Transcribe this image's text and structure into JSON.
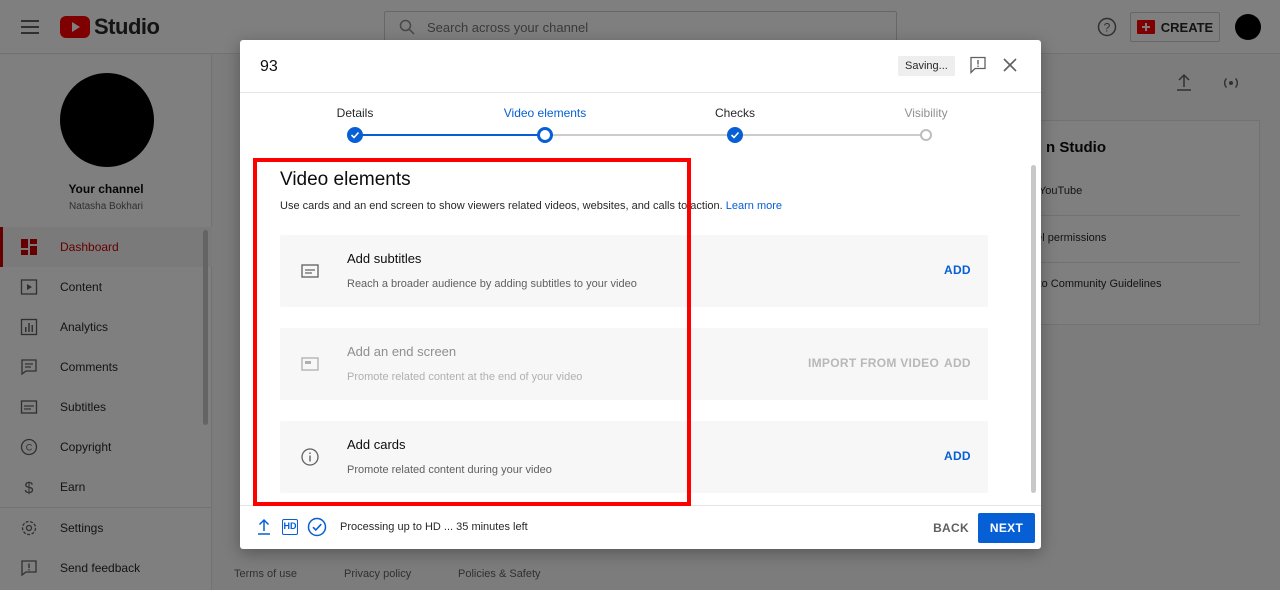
{
  "topbar": {
    "logo_text": "Studio",
    "search_placeholder": "Search across your channel",
    "create_label": "CREATE"
  },
  "sidebar": {
    "channel_title": "Your channel",
    "channel_name": "Natasha Bokhari",
    "items": [
      {
        "label": "Dashboard",
        "icon": "dashboard-icon",
        "active": true
      },
      {
        "label": "Content",
        "icon": "content-icon"
      },
      {
        "label": "Analytics",
        "icon": "analytics-icon"
      },
      {
        "label": "Comments",
        "icon": "comments-icon"
      },
      {
        "label": "Subtitles",
        "icon": "subtitles-icon"
      },
      {
        "label": "Copyright",
        "icon": "copyright-icon"
      },
      {
        "label": "Earn",
        "icon": "earn-icon"
      },
      {
        "label": "Settings",
        "icon": "settings-icon"
      },
      {
        "label": "Send feedback",
        "icon": "feedback-icon"
      }
    ]
  },
  "background": {
    "card_title": "n Studio",
    "lines": [
      "n YouTube",
      "nel permissions",
      "s to Community Guidelines"
    ],
    "footer_links": [
      "Terms of use",
      "Privacy policy",
      "Policies & Safety"
    ]
  },
  "dialog": {
    "title": "93",
    "saving_label": "Saving...",
    "steps": [
      {
        "label": "Details",
        "state": "done"
      },
      {
        "label": "Video elements",
        "state": "current"
      },
      {
        "label": "Checks",
        "state": "done"
      },
      {
        "label": "Visibility",
        "state": "todo"
      }
    ],
    "section_title": "Video elements",
    "section_desc": "Use cards and an end screen to show viewers related videos, websites, and calls to action.",
    "learn_more": "Learn more",
    "elements": [
      {
        "title": "Add subtitles",
        "desc": "Reach a broader audience by adding subtitles to your video",
        "action": "ADD",
        "icon": "subtitles-icon",
        "disabled": false
      },
      {
        "title": "Add an end screen",
        "desc": "Promote related content at the end of your video",
        "secondary_action": "IMPORT FROM VIDEO",
        "action": "ADD",
        "icon": "end-screen-icon",
        "disabled": true
      },
      {
        "title": "Add cards",
        "desc": "Promote related content during your video",
        "action": "ADD",
        "icon": "info-icon",
        "disabled": false
      }
    ],
    "footer_status": "Processing up to HD ... 35 minutes left",
    "hd_label": "HD",
    "back_label": "BACK",
    "next_label": "NEXT"
  },
  "colors": {
    "accent": "#065fd4",
    "brand_red": "#ff0000",
    "highlight": "#ff0000"
  }
}
